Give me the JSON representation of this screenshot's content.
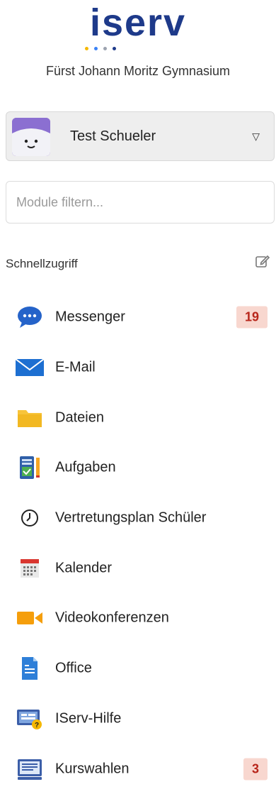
{
  "brand": {
    "logo_text": "iserv"
  },
  "school_name": "Fürst Johann Moritz Gymnasium",
  "user": {
    "name": "Test Schueler"
  },
  "filter": {
    "placeholder": "Module filtern..."
  },
  "quick_access": {
    "title": "Schnellzugriff"
  },
  "nav": {
    "items": [
      {
        "label": "Messenger",
        "icon": "messenger-icon",
        "badge": "19"
      },
      {
        "label": "E-Mail",
        "icon": "mail-icon"
      },
      {
        "label": "Dateien",
        "icon": "folder-icon"
      },
      {
        "label": "Aufgaben",
        "icon": "tasks-icon"
      },
      {
        "label": "Vertretungsplan Schüler",
        "icon": "clock-icon"
      },
      {
        "label": "Kalender",
        "icon": "calendar-icon"
      },
      {
        "label": "Videokonferenzen",
        "icon": "video-icon"
      },
      {
        "label": "Office",
        "icon": "document-icon"
      },
      {
        "label": "IServ-Hilfe",
        "icon": "help-icon"
      },
      {
        "label": "Kurswahlen",
        "icon": "course-icon",
        "badge": "3"
      }
    ]
  },
  "colors": {
    "brand": "#1e3a8a",
    "badge_bg": "#f8d7cf",
    "badge_text": "#b8261b",
    "dot_yellow": "#f5b800",
    "dot_blue": "#3b82f6",
    "dot_gray": "#9ca3af"
  }
}
